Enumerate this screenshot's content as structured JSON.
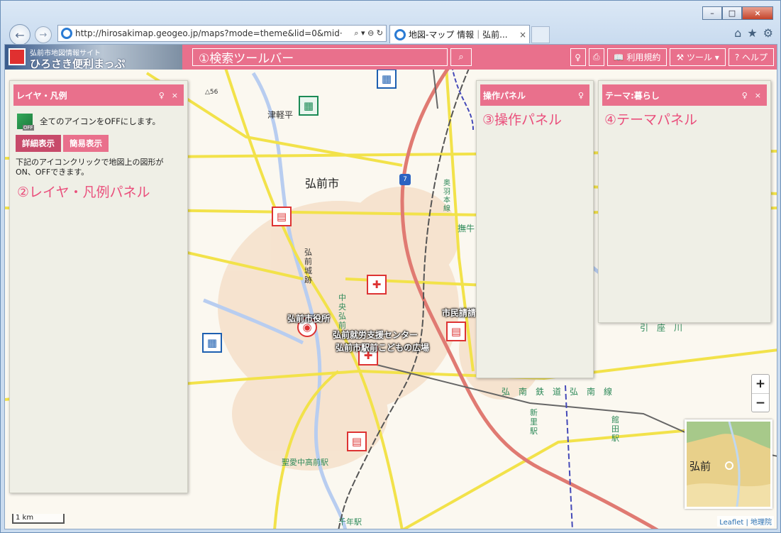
{
  "browser": {
    "url": "http://hirosakimap.geogeo.jp/maps?mode=theme&lid=0&mid·",
    "addr_ctrls": "⌕ ▾ ⊖ ↻",
    "tab_title": "地図-マップ 情報｜弘前...",
    "tab_close": "×",
    "minimize": "–",
    "maximize": "□",
    "close": "×",
    "back": "←",
    "forward": "→",
    "home": "⌂",
    "favorites": "★",
    "settings": "⚙"
  },
  "header": {
    "logo_sub": "弘前市地図情報サイト",
    "logo_main": "ひろさき便利まっぷ",
    "search_note": "①検索ツールバー",
    "search_icon": "⌕",
    "pin_icon": "♀",
    "print_icon": "⎙",
    "terms": "📖 利用規約",
    "tools": "⚒ ツール ▾",
    "help": "? ヘルプ"
  },
  "layer_panel": {
    "title": "レイヤ・凡例",
    "pin": "♀",
    "close": "×",
    "off_badge": "OFF",
    "all_off": "全てのアイコンをOFFにします。",
    "detail_btn": "詳細表示",
    "simple_btn": "簡易表示",
    "desc": "下記のアイコンクリックで地図上の図形がON、OFFできます。",
    "note": "②レイヤ・凡例パネル"
  },
  "op_panel": {
    "title": "操作パネル",
    "pin": "♀",
    "note": "③操作パネル"
  },
  "theme_panel": {
    "title": "テーマ:暮らし",
    "pin": "♀",
    "close": "×",
    "note": "④テーマパネル"
  },
  "map": {
    "city": "弘前市",
    "tsugaru": "津軽平",
    "elev": "△56",
    "castle": "弘\n前\n城\n跡",
    "chuo": "中\n央\n弘\n前",
    "city_hall": "弘前市役所",
    "shuro": "弘前就労支援センター",
    "hiroba": "弘前市駅前こどもの広場",
    "shimin": "市民請請",
    "seiai": "聖愛中高前駅",
    "konan": "弘　南　鉄　道　弘　南　線",
    "shinzato": "新\n里\n駅",
    "tateda": "館\n田\n駅",
    "chitose": "千年駅",
    "route": "7",
    "ou": "奥\n羽\n本\n線",
    "buu": "撫牛",
    "za": "引　座　川",
    "zoom_in": "+",
    "zoom_out": "−",
    "scale": "1 km",
    "attribution": "Leaflet | 地理院",
    "mini_label": "弘前"
  }
}
